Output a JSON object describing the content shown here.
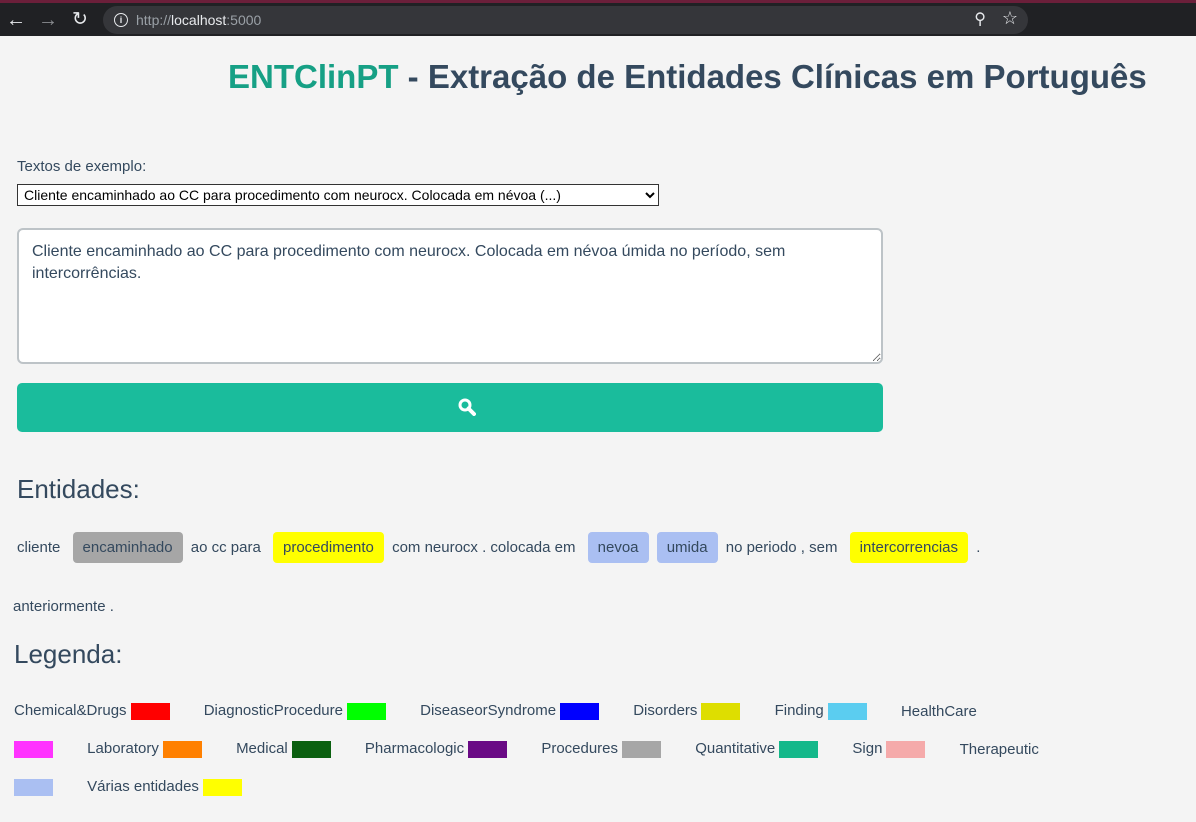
{
  "browser": {
    "url_scheme": "http://",
    "url_host": "localhost",
    "url_port": ":5000"
  },
  "header": {
    "brand": "ENTClinPT",
    "title_rest": " - Extração de Entidades Clínicas em Português"
  },
  "examples": {
    "label": "Textos de exemplo:",
    "selected": "Cliente encaminhado ao CC para procedimento com neurocx. Colocada em névoa (...)"
  },
  "input": {
    "value": "Cliente encaminhado ao CC para procedimento com neurocx. Colocada em névoa úmida no período, sem intercorrências."
  },
  "search": {
    "icon": "search-icon"
  },
  "entities": {
    "heading": "Entidades:",
    "tokens": [
      {
        "text": "cliente",
        "type": "plain"
      },
      {
        "text": "encaminhado",
        "type": "entity",
        "color": "#a6a6a6"
      },
      {
        "text": "ao cc para",
        "type": "plain"
      },
      {
        "text": "procedimento",
        "type": "entity",
        "color": "#ffff00"
      },
      {
        "text": "com neurocx . colocada em",
        "type": "plain"
      },
      {
        "text": "nevoa",
        "type": "entity",
        "color": "#aabff2"
      },
      {
        "text": "umida",
        "type": "entity",
        "color": "#aabff2"
      },
      {
        "text": "no periodo , sem",
        "type": "plain"
      },
      {
        "text": "intercorrencias",
        "type": "entity",
        "color": "#ffff00"
      },
      {
        "text": ".",
        "type": "plain"
      }
    ],
    "extra": "anteriormente ."
  },
  "legend": {
    "heading": "Legenda:",
    "items": [
      {
        "label": "Chemical&Drugs",
        "color": "#ff0000"
      },
      {
        "label": "DiagnosticProcedure",
        "color": "#00ff00"
      },
      {
        "label": "DiseaseorSyndrome",
        "color": "#0000ff"
      },
      {
        "label": "Disorders",
        "color": "#dede00"
      },
      {
        "label": "Finding",
        "color": "#5bcdf0"
      },
      {
        "label": "HealthCare",
        "color": "#ff33ff"
      },
      {
        "label": "Laboratory",
        "color": "#ff8000"
      },
      {
        "label": "Medical",
        "color": "#0b6010"
      },
      {
        "label": "Pharmacologic",
        "color": "#6a0a85"
      },
      {
        "label": "Procedures",
        "color": "#a6a6a6"
      },
      {
        "label": "Quantitative",
        "color": "#14b88a"
      },
      {
        "label": "Sign",
        "color": "#f5aaaa"
      },
      {
        "label": "Therapeutic",
        "color": "#aabff2"
      },
      {
        "label": "Várias entidades",
        "color": "#ffff00"
      }
    ]
  }
}
